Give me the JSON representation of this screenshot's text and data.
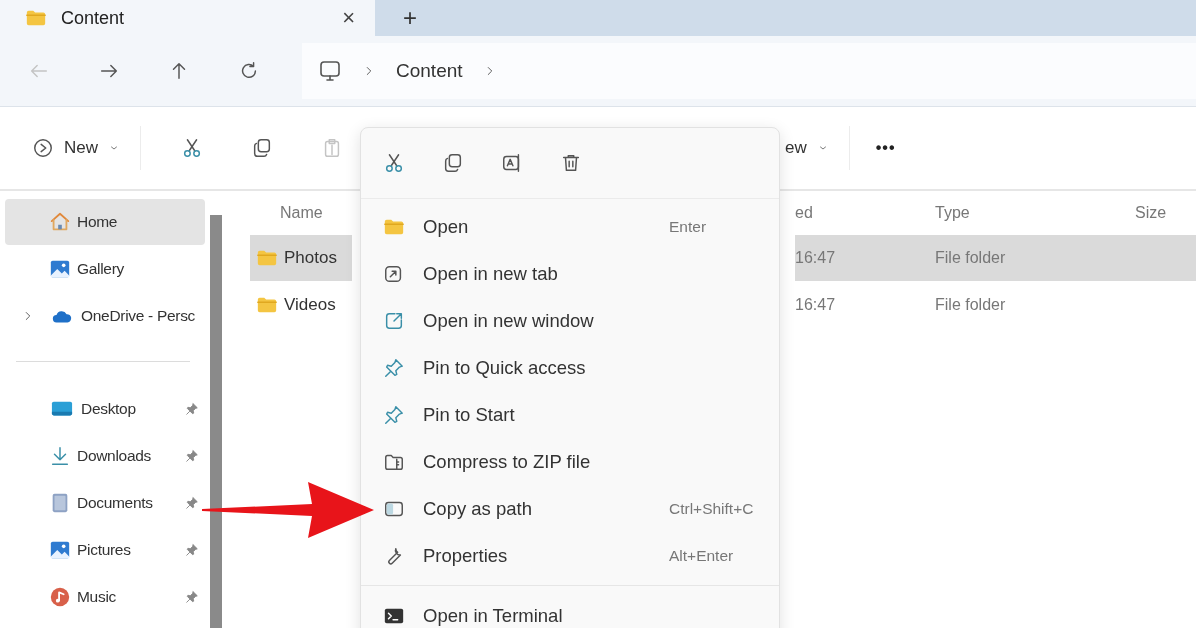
{
  "tabs": [
    {
      "label": "Content",
      "close": "×",
      "selected": true
    }
  ],
  "new_tab": "+",
  "navigation": {
    "buttons": [
      {
        "kind": "back",
        "disabled": true
      },
      {
        "kind": "forward",
        "disabled": false
      },
      {
        "kind": "up",
        "disabled": false
      },
      {
        "kind": "refresh",
        "disabled": false
      }
    ],
    "address": [
      "Content"
    ]
  },
  "toolbar": {
    "new_label": "New",
    "actions": [
      {
        "kind": "cut",
        "disabled": false
      },
      {
        "kind": "copy",
        "disabled": false
      },
      {
        "kind": "paste",
        "disabled": true
      }
    ],
    "view_label": "ew",
    "more": "•••"
  },
  "sidebar": {
    "groups": [
      {
        "items": [
          {
            "label": "Home",
            "kind": "home",
            "selected": true,
            "expandable": false,
            "pinned": false
          },
          {
            "label": "Gallery",
            "kind": "gallery",
            "selected": false,
            "expandable": false,
            "pinned": false
          },
          {
            "label": "OneDrive - Persc",
            "kind": "cloud",
            "selected": false,
            "expandable": true,
            "pinned": false
          }
        ]
      },
      {
        "items": [
          {
            "label": "Desktop",
            "kind": "desktop",
            "selected": false,
            "expandable": false,
            "pinned": true
          },
          {
            "label": "Downloads",
            "kind": "download",
            "selected": false,
            "expandable": false,
            "pinned": true
          },
          {
            "label": "Documents",
            "kind": "document",
            "selected": false,
            "expandable": false,
            "pinned": true
          },
          {
            "label": "Pictures",
            "kind": "gallery",
            "selected": false,
            "expandable": false,
            "pinned": true
          },
          {
            "label": "Music",
            "kind": "music",
            "selected": false,
            "expandable": false,
            "pinned": true
          }
        ]
      }
    ]
  },
  "file_list": {
    "columns": [
      "Name",
      "ed",
      "Type",
      "Size"
    ],
    "rows": [
      {
        "name": "Photos",
        "date": "16:47",
        "type": "File folder",
        "selected": true
      },
      {
        "name": "Videos",
        "date": "16:47",
        "type": "File folder",
        "selected": false
      }
    ]
  },
  "context_menu": {
    "quick_actions": [
      {
        "kind": "cut"
      },
      {
        "kind": "copy"
      },
      {
        "kind": "rename"
      },
      {
        "kind": "delete"
      }
    ],
    "sections": [
      {
        "items": [
          {
            "label": "Open",
            "kind": "folder",
            "shortcut": "Enter"
          },
          {
            "label": "Open in new tab",
            "kind": "newtab"
          },
          {
            "label": "Open in new window",
            "kind": "newwindow"
          },
          {
            "label": "Pin to Quick access",
            "kind": "pin"
          },
          {
            "label": "Pin to Start",
            "kind": "pin"
          },
          {
            "label": "Compress to ZIP file",
            "kind": "zip"
          },
          {
            "label": "Copy as path",
            "kind": "path",
            "shortcut": "Ctrl+Shift+C"
          },
          {
            "label": "Properties",
            "kind": "wrench",
            "shortcut": "Alt+Enter"
          }
        ]
      },
      {
        "items": [
          {
            "label": "Open in Terminal",
            "kind": "terminal"
          }
        ]
      }
    ]
  }
}
